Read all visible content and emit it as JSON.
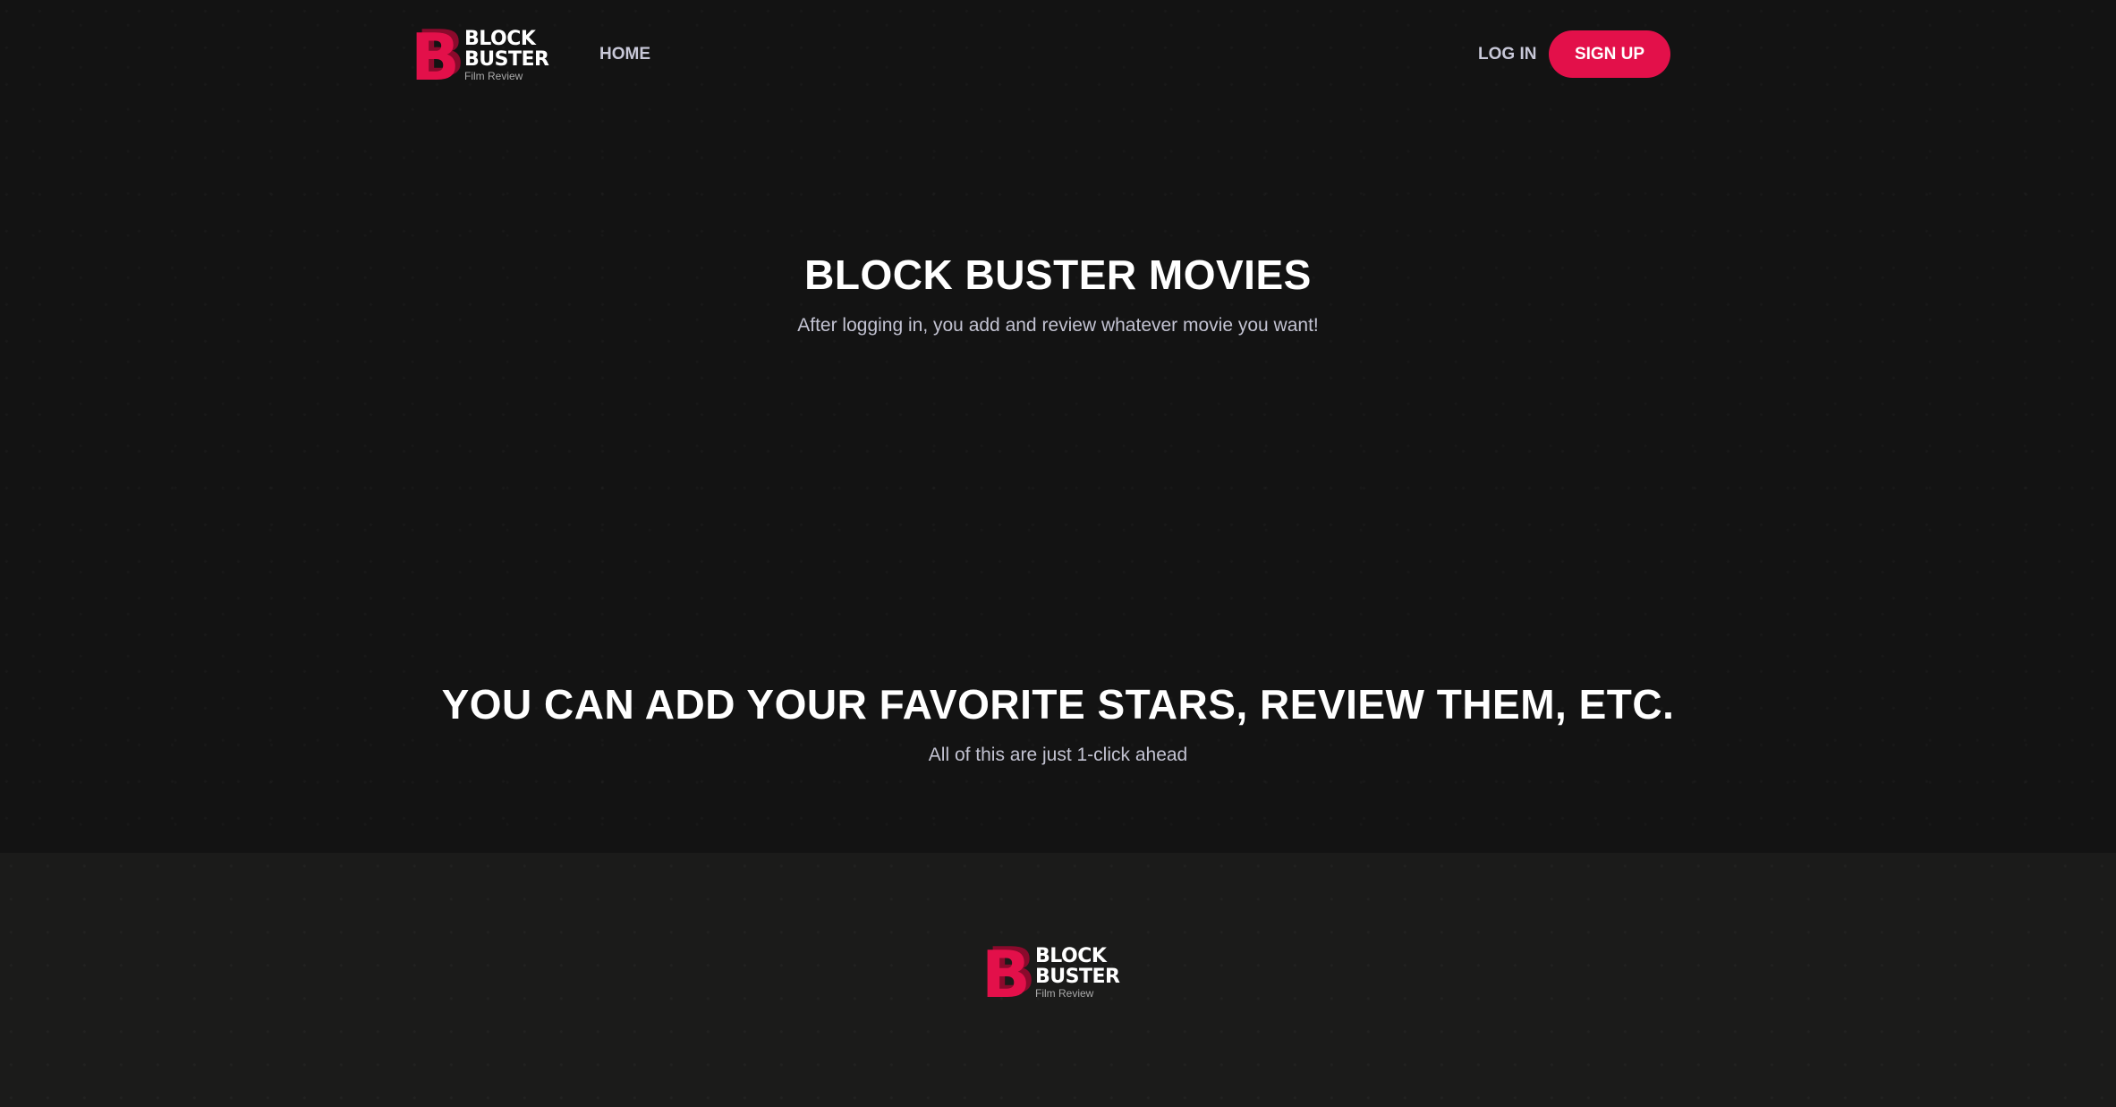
{
  "brand": {
    "word1": "BLOCK",
    "word2": "BUSTER",
    "tagline": "Film Review",
    "mark": "B",
    "accent_color": "#e3104a"
  },
  "nav": {
    "home": "HOME",
    "login": "LOG IN",
    "signup": "SIGN UP"
  },
  "hero": {
    "title": "BLOCK BUSTER MOVIES",
    "subtitle": "After logging in, you add and review whatever movie you want!"
  },
  "features": {
    "title": "YOU CAN ADD YOUR FAVORITE STARS, REVIEW THEM, ETC.",
    "subtitle": "All of this are just 1-click ahead"
  },
  "footer": {
    "word1": "BLOCK",
    "word2": "BUSTER",
    "tagline": "Film Review",
    "mark": "B"
  }
}
